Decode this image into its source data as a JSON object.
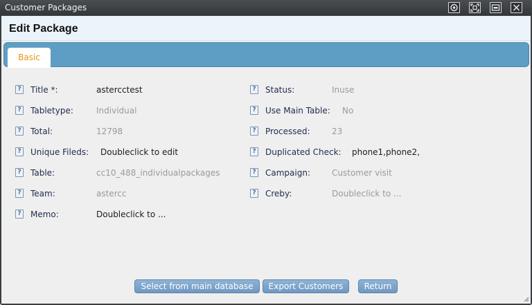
{
  "window": {
    "title": "Customer Packages",
    "controls": [
      "restore-icon",
      "maximize-icon",
      "minimize-icon",
      "close-icon"
    ]
  },
  "header": {
    "title": "Edit Package"
  },
  "tabs": [
    {
      "label": "Basic",
      "active": true
    }
  ],
  "help_glyph": "?",
  "fields": {
    "title": {
      "label": "Title *:",
      "value": "astercctest"
    },
    "status": {
      "label": "Status:",
      "value": "Inuse"
    },
    "tabletype": {
      "label": "Tabletype:",
      "value": "Individual"
    },
    "use_main_table": {
      "label": "Use Main Table:",
      "value": "No"
    },
    "total": {
      "label": "Total:",
      "value": "12798"
    },
    "processed": {
      "label": "Processed:",
      "value": "23"
    },
    "unique_fileds": {
      "label": "Unique Fileds:",
      "value": "Doubleclick to edit"
    },
    "duplicated_check": {
      "label": "Duplicated Check:",
      "value": "phone1,phone2,"
    },
    "table": {
      "label": "Table:",
      "value": "cc10_488_individualpackages"
    },
    "campaign": {
      "label": "Campaign:",
      "value": "Customer visit"
    },
    "team": {
      "label": "Team:",
      "value": "astercc"
    },
    "creby": {
      "label": "Creby:",
      "value": "Doubleclick to ..."
    },
    "memo": {
      "label": "Memo:",
      "value": "Doubleclick to ..."
    }
  },
  "buttons": {
    "select_main": "Select from main database",
    "export": "Export Customers",
    "return": "Return"
  },
  "colors": {
    "titlebar": "#3a3d40",
    "tabbar": "#5f9ec4",
    "active_tab_text": "#e8930f",
    "button": "#7aa3cc",
    "panel": "#efefef"
  }
}
